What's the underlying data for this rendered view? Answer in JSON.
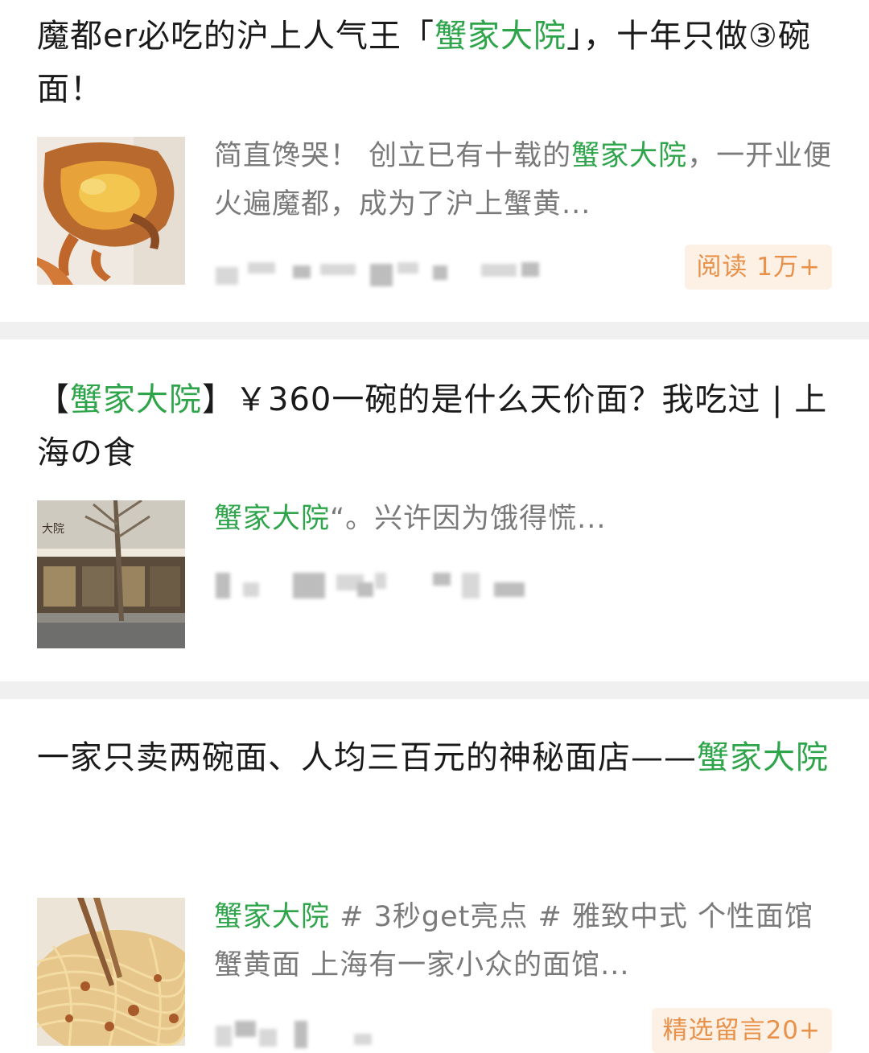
{
  "articles": [
    {
      "title_pre": "魔都er必吃的沪上人气王「",
      "title_hl": "蟹家大院",
      "title_post": "」，十年只做③碗面！",
      "digest_pre": "简直馋哭！ 创立已有十载的",
      "digest_hl": "蟹家大院",
      "digest_post": "，一开业便火遍魔都，成为了沪上蟹黄...",
      "badge": "阅读 1万+",
      "thumb_icon": "crab-photo"
    },
    {
      "title_pre": "【",
      "title_hl": "蟹家大院",
      "title_post": "】￥360一碗的是什么天价面？我吃过 | 上海の食",
      "digest_pre": "",
      "digest_hl": "蟹家大院",
      "digest_post": "“。兴许因为饿得慌...",
      "thumb_icon": "storefront-photo",
      "thumb_sign": "大院"
    },
    {
      "title_pre": "一家只卖两碗面、人均三百元的神秘面店——",
      "title_hl": "蟹家大院",
      "title_post": "",
      "digest_pre": "",
      "digest_hl": "蟹家大院",
      "digest_post": " # 3秒get亮点 # 雅致中式 个性面馆 蟹黄面 上海有一家小众的面馆...",
      "badge": "精选留言20+",
      "thumb_icon": "noodles-photo"
    }
  ],
  "colors": {
    "highlight": "#2fa54b",
    "badge_text": "#e8914a",
    "badge_bg": "#fdf0e4",
    "separator": "#f0f0f0"
  }
}
